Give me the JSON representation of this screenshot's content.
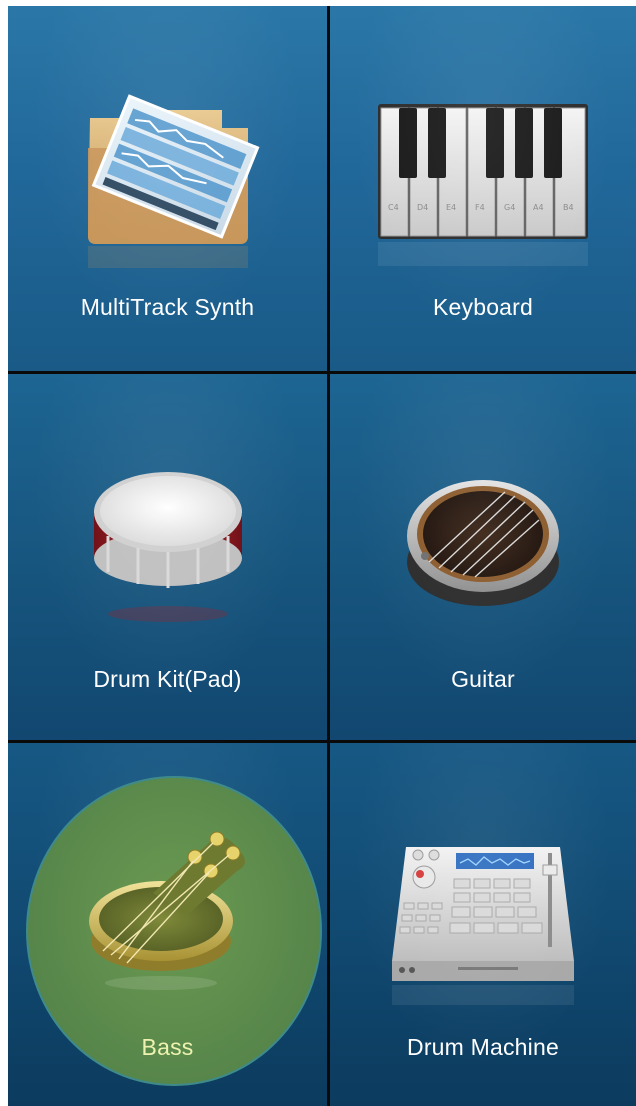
{
  "instruments": [
    {
      "label": "MultiTrack Synth",
      "icon": "multitrack-synth-icon"
    },
    {
      "label": "Keyboard",
      "icon": "keyboard-icon"
    },
    {
      "label": "Drum Kit(Pad)",
      "icon": "drum-kit-icon"
    },
    {
      "label": "Guitar",
      "icon": "guitar-icon"
    },
    {
      "label": "Bass",
      "icon": "bass-icon",
      "selected": true
    },
    {
      "label": "Drum Machine",
      "icon": "drum-machine-icon"
    }
  ],
  "keyboard_key_labels": [
    "C4",
    "D4",
    "E4",
    "F4",
    "G4",
    "A4",
    "B4"
  ],
  "colors": {
    "tile": "#195c88",
    "divider": "#0a0a0a",
    "selected_highlight": "#5b8a4c",
    "selected_text": "#eef2b0"
  }
}
